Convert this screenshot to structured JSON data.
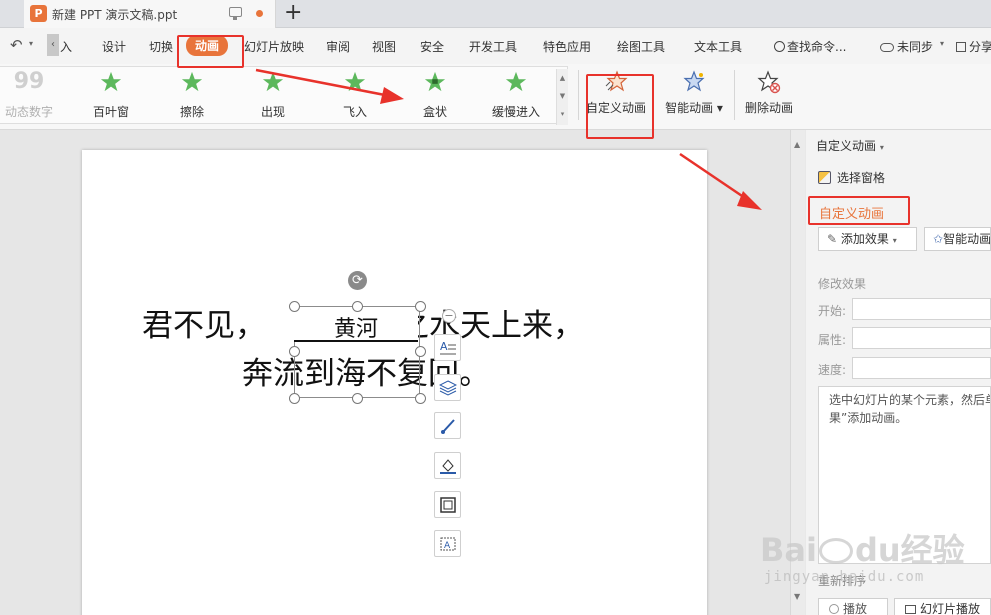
{
  "titlebar": {
    "logo_glyph": "P",
    "doc_title": "新建 PPT 演示文稿.ppt",
    "new_tab_glyph": "+"
  },
  "menu": {
    "undo_glyph": "↶",
    "scroll_left_glyph": "‹",
    "items": [
      "插入",
      "设计",
      "切换",
      "动画",
      "幻灯片放映",
      "审阅",
      "视图",
      "安全",
      "开发工具",
      "特色应用",
      "绘图工具",
      "文本工具"
    ],
    "active": "动画",
    "insert_visible": "插入",
    "search": "查找命令...",
    "sync": "未同步",
    "share": "分享"
  },
  "ribbon": {
    "effects": [
      {
        "label": "动态数字",
        "icon": "number-99-icon",
        "glyph": "99",
        "disabled": true
      },
      {
        "label": "百叶窗",
        "icon": "star-green-icon"
      },
      {
        "label": "擦除",
        "icon": "star-green-icon"
      },
      {
        "label": "出现",
        "icon": "star-green-icon"
      },
      {
        "label": "飞入",
        "icon": "star-green-icon"
      },
      {
        "label": "盒状",
        "icon": "star-green-icon"
      },
      {
        "label": "缓慢进入",
        "icon": "star-green-icon"
      }
    ],
    "custom_animation": "自定义动画",
    "smart_animation": "智能动画",
    "delete_animation": "删除动画",
    "scroll_up_glyph": "▲",
    "scroll_down_glyph": "▼",
    "scroll_more_glyph": "▾"
  },
  "slide": {
    "line1": "君不见，",
    "line1_tail": "之水天上来，",
    "line2": "奔流到海不复回。",
    "textbox_text": "黄河",
    "rotate_glyph": "⟳",
    "minus_glyph": "−"
  },
  "panel": {
    "title": "自定义动画",
    "selection_pane": "选择窗格",
    "custom_animation": "自定义动画",
    "add_effect": "添加效果",
    "smart_animation": "智能动画",
    "modify_effect": "修改效果",
    "start_label": "开始:",
    "property_label": "属性:",
    "speed_label": "速度:",
    "hint_line1": "选中幻灯片的某个元素，然后单",
    "hint_line2": "果”添加动画。",
    "reorder": "重新排序",
    "play": "播放",
    "slideshow": "幻灯片播放"
  },
  "watermark": {
    "brand": "Bai",
    "brand_tail": "经验",
    "site": "jingyan.baidu.com"
  },
  "colors": {
    "accent": "#e8743b",
    "annotation_red": "#e8322b",
    "star_green": "#5cb85c"
  }
}
